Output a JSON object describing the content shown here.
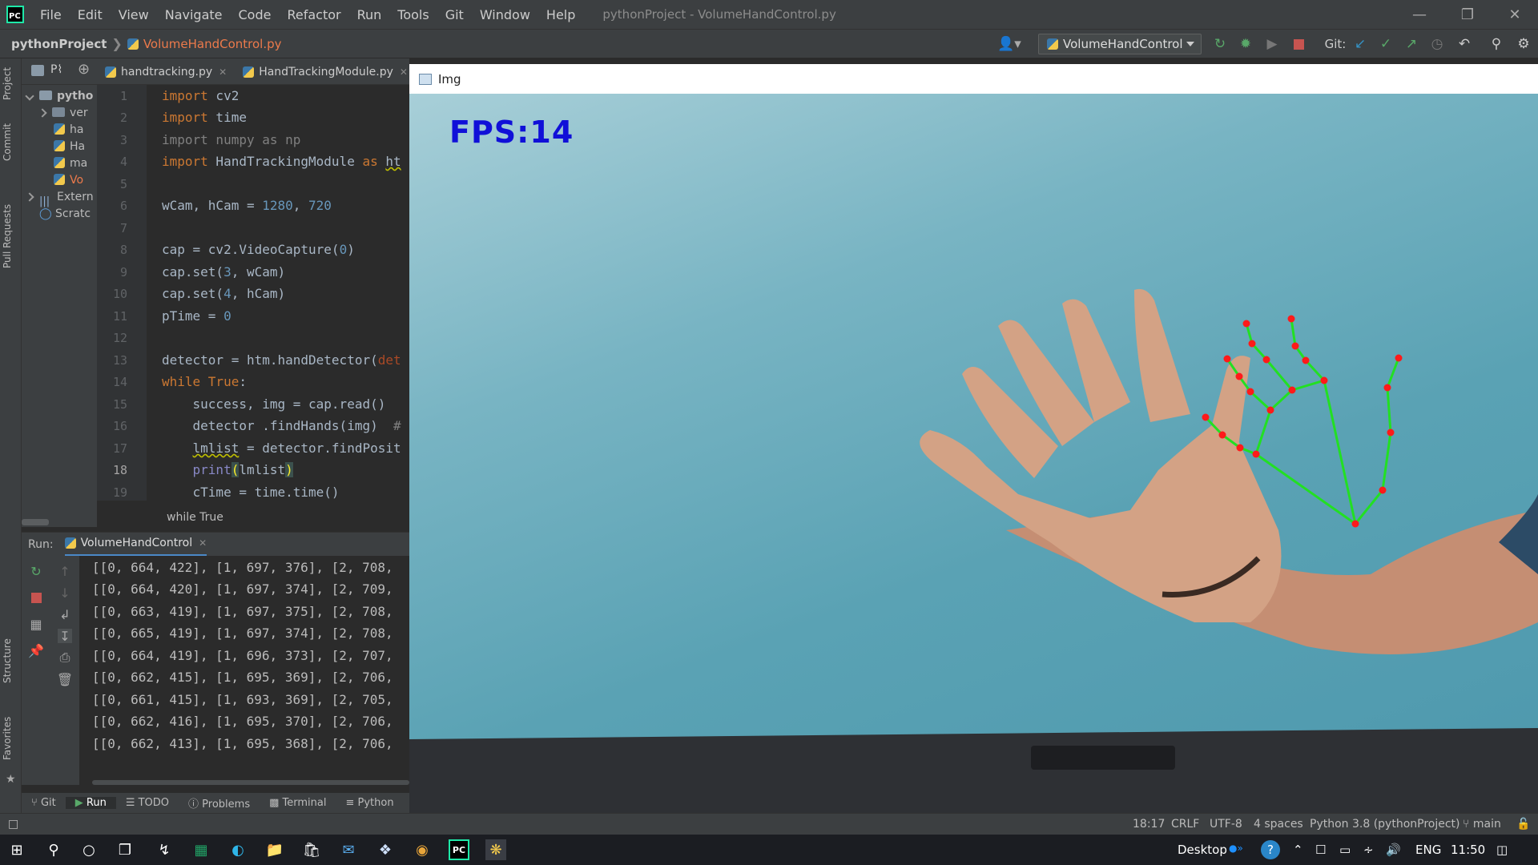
{
  "app": {
    "title": "pythonProject - VolumeHandControl.py",
    "menu": [
      "File",
      "Edit",
      "View",
      "Navigate",
      "Code",
      "Refactor",
      "Run",
      "Tools",
      "Git",
      "Window",
      "Help"
    ]
  },
  "navbar": {
    "project": "pythonProject",
    "file": "VolumeHandControl.py",
    "run_config": "VolumeHandControl",
    "git_label": "Git:"
  },
  "sidebar_labels": [
    "Project",
    "Commit",
    "Pull Requests",
    "Structure",
    "Favorites"
  ],
  "project_tree": {
    "header": "P⌇",
    "items": [
      {
        "label": "pytho",
        "kind": "folder"
      },
      {
        "label": "ver",
        "kind": "folder"
      },
      {
        "label": "ha",
        "kind": "py"
      },
      {
        "label": "Ha",
        "kind": "py"
      },
      {
        "label": "ma",
        "kind": "py"
      },
      {
        "label": "Vo",
        "kind": "py"
      },
      {
        "label": "Extern",
        "kind": "lib"
      },
      {
        "label": "Scratc",
        "kind": "scratch"
      }
    ]
  },
  "editor": {
    "tabs": [
      "handtracking.py",
      "HandTrackingModule.py"
    ],
    "line_numbers": [
      "1",
      "2",
      "3",
      "4",
      "5",
      "6",
      "7",
      "8",
      "9",
      "10",
      "11",
      "12",
      "13",
      "14",
      "15",
      "16",
      "17",
      "18",
      "19"
    ],
    "code_breadcrumb": "while True"
  },
  "run": {
    "label": "Run:",
    "tab": "VolumeHandControl",
    "output": [
      "[[0, 664, 422], [1, 697, 376], [2, 708,",
      "[[0, 664, 420], [1, 697, 374], [2, 709,",
      "[[0, 663, 419], [1, 697, 375], [2, 708,",
      "[[0, 665, 419], [1, 697, 374], [2, 708,",
      "[[0, 664, 419], [1, 696, 373], [2, 707,",
      "[[0, 662, 415], [1, 695, 369], [2, 706,",
      "[[0, 661, 415], [1, 693, 369], [2, 705,",
      "[[0, 662, 416], [1, 695, 370], [2, 706,",
      "[[0, 662, 413], [1, 695, 368], [2, 706,"
    ]
  },
  "bottom_tabs": [
    "Git",
    "Run",
    "TODO",
    "Problems",
    "Terminal",
    "Python"
  ],
  "status": {
    "position": "18:17",
    "line_sep": "CRLF",
    "encoding": "UTF-8",
    "indent": "4 spaces",
    "interpreter": "Python 3.8 (pythonProject)",
    "branch": "main"
  },
  "img_window": {
    "title": "Img",
    "fps_text": "FPS:14"
  },
  "taskbar": {
    "desktop": "Desktop",
    "lang": "ENG",
    "time": "11:50"
  },
  "colors": {
    "ide_bg": "#2b2b2b",
    "panel": "#3c3f41",
    "keyword": "#cc7832",
    "number": "#6897bb",
    "landmark": "#ff1a1a",
    "connection": "#22e022",
    "fps": "#1010d8"
  }
}
